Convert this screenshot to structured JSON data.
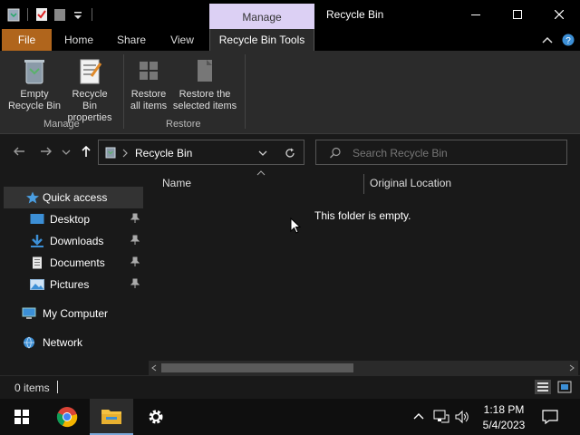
{
  "window": {
    "manage_tab": "Manage",
    "title": "Recycle Bin"
  },
  "ribbon_tabs": {
    "file": "File",
    "home": "Home",
    "share": "Share",
    "view": "View",
    "tools": "Recycle Bin Tools"
  },
  "ribbon": {
    "empty_line1": "Empty",
    "empty_line2": "Recycle Bin",
    "props_line1": "Recycle Bin",
    "props_line2": "properties",
    "restore_all_line1": "Restore",
    "restore_all_line2": "all items",
    "restore_sel_line1": "Restore the",
    "restore_sel_line2": "selected items",
    "group_manage": "Manage",
    "group_restore": "Restore"
  },
  "address": {
    "path": "Recycle Bin",
    "search_placeholder": "Search Recycle Bin"
  },
  "sidebar": {
    "items": [
      {
        "label": "Quick access"
      },
      {
        "label": "Desktop"
      },
      {
        "label": "Downloads"
      },
      {
        "label": "Documents"
      },
      {
        "label": "Pictures"
      },
      {
        "label": "My Computer"
      },
      {
        "label": "Network"
      }
    ]
  },
  "content": {
    "col_name": "Name",
    "col_location": "Original Location",
    "empty_message": "This folder is empty."
  },
  "status": {
    "count": "0 items"
  },
  "taskbar": {
    "time": "1:18 PM",
    "date": "5/4/2023"
  },
  "colors": {
    "file_tab": "#b0651c",
    "manage_tab": "#dcd0f4",
    "accent": "#4a9de0"
  }
}
